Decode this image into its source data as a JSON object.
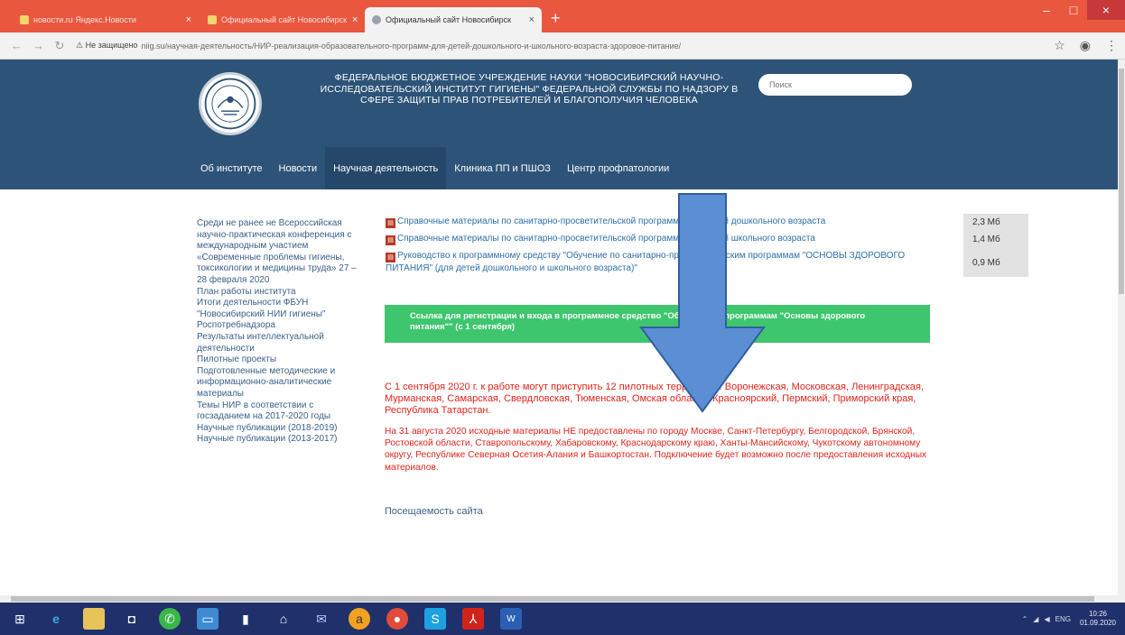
{
  "browser": {
    "tabs": [
      {
        "label": "новости.ru   Яндекс.Новости"
      },
      {
        "label": "Официальный сайт Новосибирск"
      },
      {
        "label": "Официальный сайт Новосибирск"
      }
    ],
    "new_tab_glyph": "+",
    "security_label": "⚠ Не защищено",
    "url": "niig.su/научная-деятельность/НИР-реализация-образовательного-программ-для-детей-дошкольного-и-школьного-возраста-здоровое-питание/"
  },
  "site": {
    "title": "ФЕДЕРАЛЬНОЕ БЮДЖЕТНОЕ УЧРЕЖДЕНИЕ НАУКИ \"НОВОСИБИРСКИЙ НАУЧНО-ИССЛЕДОВАТЕЛЬСКИЙ ИНСТИТУТ ГИГИЕНЫ\" ФЕДЕРАЛЬНОЙ СЛУЖБЫ ПО НАДЗОРУ В СФЕРЕ ЗАЩИТЫ ПРАВ ПОТРЕБИТЕЛЕЙ И БЛАГОПОЛУЧИЯ ЧЕЛОВЕКА",
    "search_placeholder": "Поиск",
    "nav": [
      {
        "label": "Об институте"
      },
      {
        "label": "Новости"
      },
      {
        "label": "Научная деятельность",
        "active": true
      },
      {
        "label": "Клиника ПП и ПШОЗ"
      },
      {
        "label": "Центр профпатологии"
      }
    ],
    "sidebar": [
      {
        "label": "Среди не ранее не Всероссийская научно-практическая конференция с международным участием «Современные проблемы гигиены, токсикологии и медицины труда» 27 – 28 февраля 2020"
      },
      {
        "label": "План работы института"
      },
      {
        "label": "Итоги деятельности ФБУН \"Новосибирский НИИ гигиены\" Роспотребнадзора"
      },
      {
        "label": "Результаты интеллектуальной деятельности"
      },
      {
        "label": "Пилотные проекты"
      },
      {
        "label": "Подготовленные методические и информационно-аналитические материалы"
      },
      {
        "label": "Темы НИР в соответствии с госзаданием на 2017-2020 годы"
      },
      {
        "label": "Научные публикации (2018-2019)"
      },
      {
        "label": "Научные публикации (2013-2017)"
      }
    ],
    "downloads": [
      {
        "label": "Справочные материалы по санитарно-просветительской программе для детей дошкольного возраста",
        "size": "2,3 Мб"
      },
      {
        "label": "Справочные материалы по санитарно-просветительской программе для детей школьного возраста",
        "size": "1,4 Мб"
      },
      {
        "label": "Руководство к программному средству \"Обучение по санитарно-просветительским программам \"ОСНОВЫ ЗДОРОВОГО ПИТАНИЯ\" (для детей дошкольного и школьного возраста)\"",
        "size": "0,9 Мб"
      }
    ],
    "registration_button": "Ссылка для регистрации и входа в программное средство \"Обучение по программам \"Основы здорового питания\"\" (с 1 сентября)",
    "notice_1": "С 1 сентября 2020 г. к работе могут приступить 12 пилотных территорий: Воронежская, Московская, Ленинградская, Мурманская, Самарская, Свердловская, Тюменская, Омская области, Красноярский, Пермский, Приморский края, Республика Татарстан.",
    "notice_2": "На 31 августа 2020 исходные материалы НЕ предоставлены по городу Москве, Санкт-Петербургу, Белгородской, Брянской, Ростовской области, Ставропольскому, Хабаровскому, Краснодарскому краю, Ханты-Мансийскому, Чукотскому автономному округу, Республике Северная Осетия-Алания и Башкортостан. Подключение будет возможно после предоставления исходных материалов.",
    "visits_link": "Посещаемость сайта"
  },
  "taskbar": {
    "icons": [
      "windows-start-icon",
      "edge-icon",
      "file-explorer-icon",
      "office-icon",
      "whatsapp-icon",
      "computer-icon",
      "file-icon",
      "home-icon",
      "mail-icon",
      "avast-icon",
      "chrome-icon",
      "skype-icon",
      "acrobat-icon",
      "word-icon"
    ],
    "tray_lang": "ENG",
    "time": "10:26",
    "date": "01.09.2020"
  },
  "colors": {
    "tab_strip": "#e9573f",
    "header": "#2d5478",
    "nav_active": "#24476a",
    "button_green": "#3dc66d",
    "notice_red": "#e0241b",
    "link_blue": "#3b5f8a",
    "arrow_blue": "#5b8ed3",
    "taskbar": "#20306b"
  }
}
